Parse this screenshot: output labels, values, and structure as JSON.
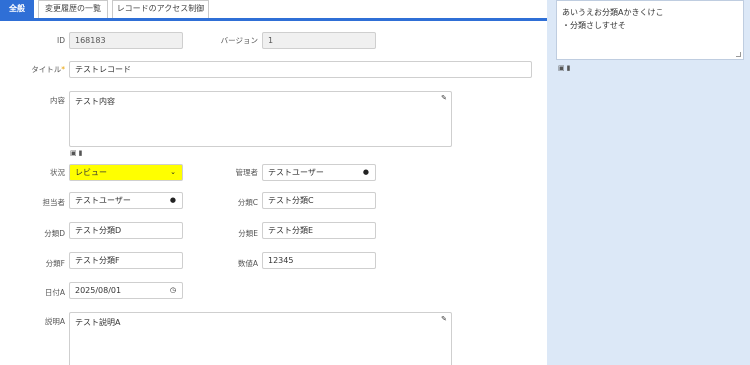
{
  "tabs": [
    {
      "label": "全般",
      "active": true
    },
    {
      "label": "変更履歴の一覧",
      "active": false
    },
    {
      "label": "レコードのアクセス制御",
      "active": false
    }
  ],
  "form": {
    "id": {
      "label": "ID",
      "value": "168183"
    },
    "version": {
      "label": "バージョン",
      "value": "1"
    },
    "title": {
      "label": "タイトル",
      "required_mark": "*",
      "value": "テストレコード"
    },
    "body": {
      "label": "内容",
      "value": "テスト内容"
    },
    "status": {
      "label": "状況",
      "value": "レビュー"
    },
    "manager": {
      "label": "管理者",
      "value": "テストユーザー"
    },
    "owner": {
      "label": "担当者",
      "value": "テストユーザー"
    },
    "class_c": {
      "label": "分類C",
      "value": "テスト分類C"
    },
    "class_d": {
      "label": "分類D",
      "value": "テスト分類D"
    },
    "class_e": {
      "label": "分類E",
      "value": "テスト分類E"
    },
    "class_f": {
      "label": "分類F",
      "value": "テスト分類F"
    },
    "num_a": {
      "label": "数値A",
      "value": "12345"
    },
    "date_a": {
      "label": "日付A",
      "value": "2025/08/01"
    },
    "desc_a": {
      "label": "説明A",
      "value": "テスト説明A"
    }
  },
  "side_panel": {
    "line1": "あいうえお分類Aかきくけこ",
    "line2": "・分類さしすせそ"
  },
  "colors": {
    "accent": "#2f6fd6",
    "status_highlight": "#ffff00",
    "side_panel_bg": "#dce8f7"
  }
}
